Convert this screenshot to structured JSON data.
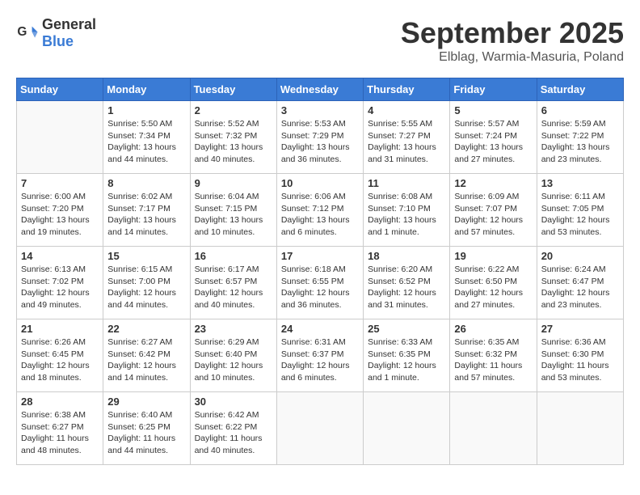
{
  "header": {
    "logo": {
      "general": "General",
      "blue": "Blue"
    },
    "title": "September 2025",
    "location": "Elblag, Warmia-Masuria, Poland"
  },
  "weekdays": [
    "Sunday",
    "Monday",
    "Tuesday",
    "Wednesday",
    "Thursday",
    "Friday",
    "Saturday"
  ],
  "weeks": [
    [
      {
        "day": "",
        "info": ""
      },
      {
        "day": "1",
        "info": "Sunrise: 5:50 AM\nSunset: 7:34 PM\nDaylight: 13 hours\nand 44 minutes."
      },
      {
        "day": "2",
        "info": "Sunrise: 5:52 AM\nSunset: 7:32 PM\nDaylight: 13 hours\nand 40 minutes."
      },
      {
        "day": "3",
        "info": "Sunrise: 5:53 AM\nSunset: 7:29 PM\nDaylight: 13 hours\nand 36 minutes."
      },
      {
        "day": "4",
        "info": "Sunrise: 5:55 AM\nSunset: 7:27 PM\nDaylight: 13 hours\nand 31 minutes."
      },
      {
        "day": "5",
        "info": "Sunrise: 5:57 AM\nSunset: 7:24 PM\nDaylight: 13 hours\nand 27 minutes."
      },
      {
        "day": "6",
        "info": "Sunrise: 5:59 AM\nSunset: 7:22 PM\nDaylight: 13 hours\nand 23 minutes."
      }
    ],
    [
      {
        "day": "7",
        "info": "Sunrise: 6:00 AM\nSunset: 7:20 PM\nDaylight: 13 hours\nand 19 minutes."
      },
      {
        "day": "8",
        "info": "Sunrise: 6:02 AM\nSunset: 7:17 PM\nDaylight: 13 hours\nand 14 minutes."
      },
      {
        "day": "9",
        "info": "Sunrise: 6:04 AM\nSunset: 7:15 PM\nDaylight: 13 hours\nand 10 minutes."
      },
      {
        "day": "10",
        "info": "Sunrise: 6:06 AM\nSunset: 7:12 PM\nDaylight: 13 hours\nand 6 minutes."
      },
      {
        "day": "11",
        "info": "Sunrise: 6:08 AM\nSunset: 7:10 PM\nDaylight: 13 hours\nand 1 minute."
      },
      {
        "day": "12",
        "info": "Sunrise: 6:09 AM\nSunset: 7:07 PM\nDaylight: 12 hours\nand 57 minutes."
      },
      {
        "day": "13",
        "info": "Sunrise: 6:11 AM\nSunset: 7:05 PM\nDaylight: 12 hours\nand 53 minutes."
      }
    ],
    [
      {
        "day": "14",
        "info": "Sunrise: 6:13 AM\nSunset: 7:02 PM\nDaylight: 12 hours\nand 49 minutes."
      },
      {
        "day": "15",
        "info": "Sunrise: 6:15 AM\nSunset: 7:00 PM\nDaylight: 12 hours\nand 44 minutes."
      },
      {
        "day": "16",
        "info": "Sunrise: 6:17 AM\nSunset: 6:57 PM\nDaylight: 12 hours\nand 40 minutes."
      },
      {
        "day": "17",
        "info": "Sunrise: 6:18 AM\nSunset: 6:55 PM\nDaylight: 12 hours\nand 36 minutes."
      },
      {
        "day": "18",
        "info": "Sunrise: 6:20 AM\nSunset: 6:52 PM\nDaylight: 12 hours\nand 31 minutes."
      },
      {
        "day": "19",
        "info": "Sunrise: 6:22 AM\nSunset: 6:50 PM\nDaylight: 12 hours\nand 27 minutes."
      },
      {
        "day": "20",
        "info": "Sunrise: 6:24 AM\nSunset: 6:47 PM\nDaylight: 12 hours\nand 23 minutes."
      }
    ],
    [
      {
        "day": "21",
        "info": "Sunrise: 6:26 AM\nSunset: 6:45 PM\nDaylight: 12 hours\nand 18 minutes."
      },
      {
        "day": "22",
        "info": "Sunrise: 6:27 AM\nSunset: 6:42 PM\nDaylight: 12 hours\nand 14 minutes."
      },
      {
        "day": "23",
        "info": "Sunrise: 6:29 AM\nSunset: 6:40 PM\nDaylight: 12 hours\nand 10 minutes."
      },
      {
        "day": "24",
        "info": "Sunrise: 6:31 AM\nSunset: 6:37 PM\nDaylight: 12 hours\nand 6 minutes."
      },
      {
        "day": "25",
        "info": "Sunrise: 6:33 AM\nSunset: 6:35 PM\nDaylight: 12 hours\nand 1 minute."
      },
      {
        "day": "26",
        "info": "Sunrise: 6:35 AM\nSunset: 6:32 PM\nDaylight: 11 hours\nand 57 minutes."
      },
      {
        "day": "27",
        "info": "Sunrise: 6:36 AM\nSunset: 6:30 PM\nDaylight: 11 hours\nand 53 minutes."
      }
    ],
    [
      {
        "day": "28",
        "info": "Sunrise: 6:38 AM\nSunset: 6:27 PM\nDaylight: 11 hours\nand 48 minutes."
      },
      {
        "day": "29",
        "info": "Sunrise: 6:40 AM\nSunset: 6:25 PM\nDaylight: 11 hours\nand 44 minutes."
      },
      {
        "day": "30",
        "info": "Sunrise: 6:42 AM\nSunset: 6:22 PM\nDaylight: 11 hours\nand 40 minutes."
      },
      {
        "day": "",
        "info": ""
      },
      {
        "day": "",
        "info": ""
      },
      {
        "day": "",
        "info": ""
      },
      {
        "day": "",
        "info": ""
      }
    ]
  ]
}
